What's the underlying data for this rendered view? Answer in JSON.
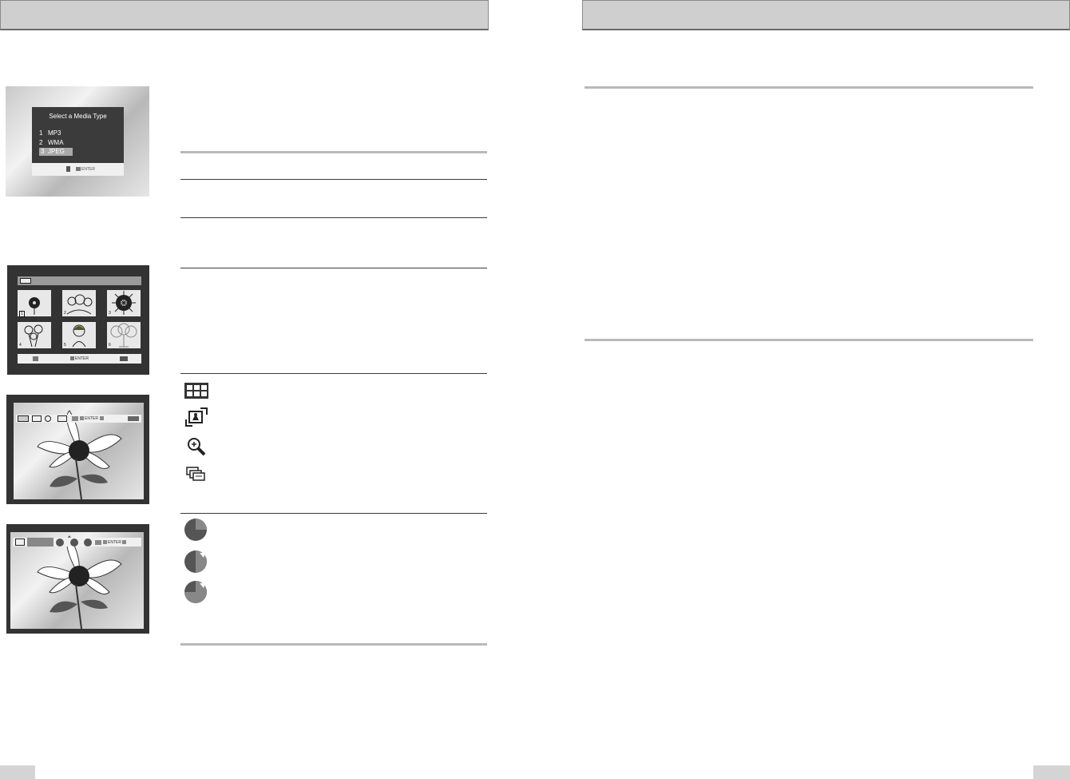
{
  "media_menu": {
    "title": "Select a Media Type",
    "items": [
      {
        "num": "1",
        "label": "MP3"
      },
      {
        "num": "2",
        "label": "WMA"
      },
      {
        "num": "3",
        "label": "JPEG"
      }
    ],
    "selected_index": 3,
    "footer_enter": "ENTER"
  },
  "thumbnail_screen": {
    "numbers": [
      "1",
      "2",
      "3",
      "4",
      "5",
      "6"
    ],
    "footer_enter": "ENTER"
  },
  "view_toolbar": {
    "enter": "ENTER"
  },
  "rotate_toolbar": {
    "enter": "ENTER"
  },
  "icons": [
    "thumbnail-grid-icon",
    "rotate-image-icon",
    "zoom-icon",
    "slide-show-icon",
    "interval-pie-quarter-icon",
    "interval-pie-half-icon",
    "interval-pie-three-quarter-icon"
  ]
}
